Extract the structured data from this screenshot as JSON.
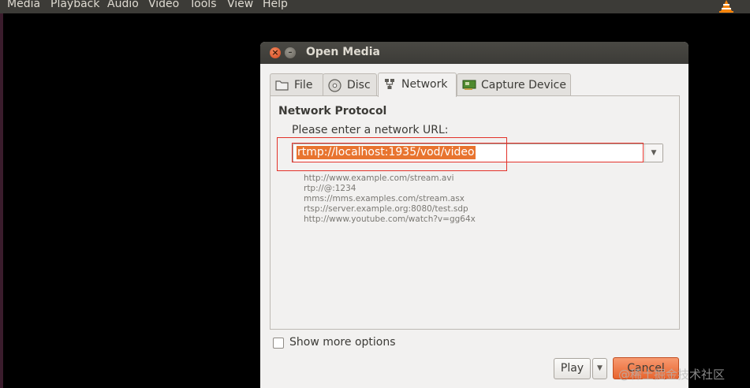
{
  "menubar": {
    "items": [
      "Media",
      "Playback",
      "Audio",
      "Video",
      "Tools",
      "View",
      "Help"
    ]
  },
  "dialog": {
    "title": "Open Media",
    "tabs": [
      {
        "label": "File",
        "icon": "folder-icon",
        "active": false
      },
      {
        "label": "Disc",
        "icon": "disc-icon",
        "active": false
      },
      {
        "label": "Network",
        "icon": "network-icon",
        "active": true
      },
      {
        "label": "Capture Device",
        "icon": "capture-card-icon",
        "active": false
      }
    ],
    "network": {
      "group_title": "Network Protocol",
      "url_label": "Please enter a network URL:",
      "url_value": "rtmp://localhost:1935/vod/video",
      "examples": [
        "http://www.example.com/stream.avi",
        "rtp://@:1234",
        "mms://mms.examples.com/stream.asx",
        "rtsp://server.example.org:8080/test.sdp",
        "http://www.youtube.com/watch?v=gg64x"
      ]
    },
    "show_more_options": "Show more options",
    "play_label": "Play",
    "cancel_label": "Cancel"
  },
  "watermark": "@稀土掘金技术社区",
  "colors": {
    "menubar_bg": "#3c3b37",
    "selection": "#e8742f",
    "cancel_button": "#e8642e",
    "annotation": "#e3322a"
  }
}
